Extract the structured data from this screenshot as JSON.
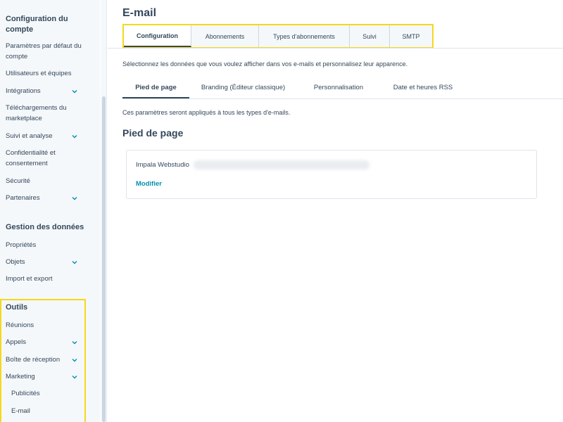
{
  "sidebar": {
    "account_title": "Configuration du compte",
    "account_items": [
      {
        "label": "Paramètres par défaut du compte",
        "expandable": false
      },
      {
        "label": "Utilisateurs et équipes",
        "expandable": false
      },
      {
        "label": "Intégrations",
        "expandable": true
      },
      {
        "label": "Téléchargements du marketplace",
        "expandable": false
      },
      {
        "label": "Suivi et analyse",
        "expandable": true
      },
      {
        "label": "Confidentialité et consentement",
        "expandable": false
      },
      {
        "label": "Sécurité",
        "expandable": false
      },
      {
        "label": "Partenaires",
        "expandable": true
      }
    ],
    "data_title": "Gestion des données",
    "data_items": [
      {
        "label": "Propriétés",
        "expandable": false
      },
      {
        "label": "Objets",
        "expandable": true
      },
      {
        "label": "Import et export",
        "expandable": false
      }
    ],
    "tools_title": "Outils",
    "tools_items": [
      {
        "label": "Réunions",
        "expandable": false
      },
      {
        "label": "Appels",
        "expandable": true
      },
      {
        "label": "Boîte de réception",
        "expandable": true
      },
      {
        "label": "Marketing",
        "expandable": true
      },
      {
        "label": "Publicités",
        "expandable": false
      },
      {
        "label": "E-mail",
        "expandable": false
      }
    ]
  },
  "main": {
    "title": "E-mail",
    "tabs": [
      {
        "label": "Configuration",
        "active": true
      },
      {
        "label": "Abonnements",
        "active": false
      },
      {
        "label": "Types d'abonnements",
        "active": false
      },
      {
        "label": "Suivi",
        "active": false
      },
      {
        "label": "SMTP",
        "active": false
      }
    ],
    "description": "Sélectionnez les données que vous voulez afficher dans vos e-mails et personnalisez leur apparence.",
    "subtabs": [
      {
        "label": "Pied de page",
        "active": true
      },
      {
        "label": "Branding (Éditeur classique)",
        "active": false
      },
      {
        "label": "Personnalisation",
        "active": false
      },
      {
        "label": "Date et heures RSS",
        "active": false
      }
    ],
    "note": "Ces paramètres seront appliqués à tous les types d'e-mails.",
    "section_heading": "Pied de page",
    "footer_card": {
      "company_name": "Impala Webstudio",
      "edit_label": "Modifier"
    }
  },
  "colors": {
    "accent_link": "#0091ae",
    "text": "#33475b",
    "highlight": "#f5d81d",
    "sidebar_bg": "#f5f8fa"
  },
  "icons": {
    "expand": "chevron-down-icon"
  }
}
